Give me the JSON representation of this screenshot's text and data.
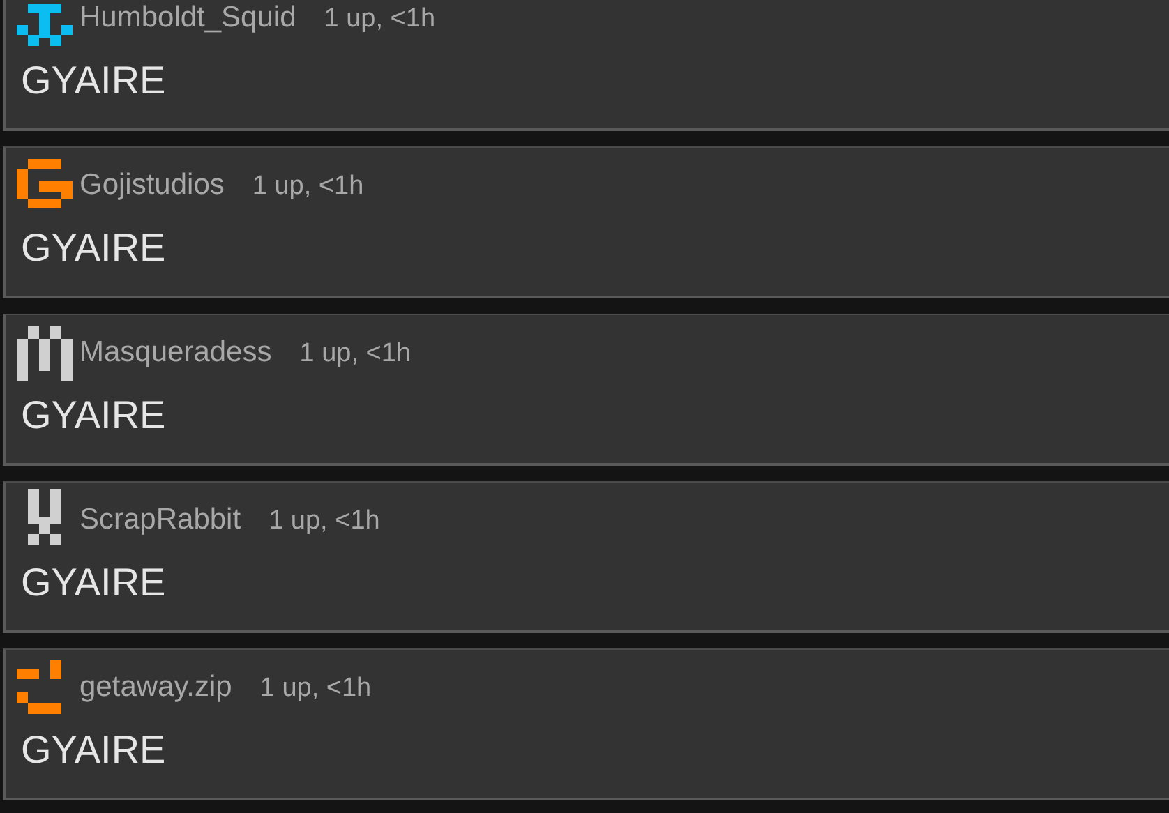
{
  "posts": [
    {
      "user": "Humboldt_Squid",
      "meta": "1 up, <1h",
      "title": "GYAIRE"
    },
    {
      "user": "Gojistudios",
      "meta": "1 up, <1h",
      "title": "GYAIRE"
    },
    {
      "user": "Masqueradess",
      "meta": "1 up, <1h",
      "title": "GYAIRE"
    },
    {
      "user": "ScrapRabbit",
      "meta": "1 up, <1h",
      "title": "GYAIRE"
    },
    {
      "user": "getaway.zip",
      "meta": "1 up, <1h",
      "title": "GYAIRE"
    }
  ]
}
